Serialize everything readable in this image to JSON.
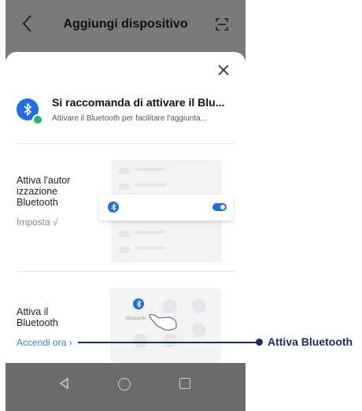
{
  "header": {
    "title": "Aggiungi dispositivo",
    "back_icon": "chevron-left-icon",
    "scan_icon": "scan-icon"
  },
  "sheet": {
    "close_icon": "close-icon",
    "recommendation": {
      "title": "Si raccomanda di attivare il Blu...",
      "subtitle": "Attivare il Bluetooth per facilitare l'aggiunta..."
    },
    "step1": {
      "title": "Attiva l'autor izzazione Bluetooth",
      "action": "Imposta √"
    },
    "step2": {
      "title": "Attiva il Bluetooth",
      "action": "Accendi ora ›",
      "illustration_label": "Bluetooth"
    }
  },
  "navbar": {
    "back_icon": "nav-back-icon",
    "home_icon": "nav-home-icon",
    "recent_icon": "nav-recent-icon"
  },
  "annotation": {
    "label": "Attiva Bluetooth",
    "color": "#1a2a6c"
  },
  "colors": {
    "accent": "#1e6fe6",
    "link": "#2a82e6",
    "success": "#22b573",
    "overlay": "#7a7a7a"
  }
}
